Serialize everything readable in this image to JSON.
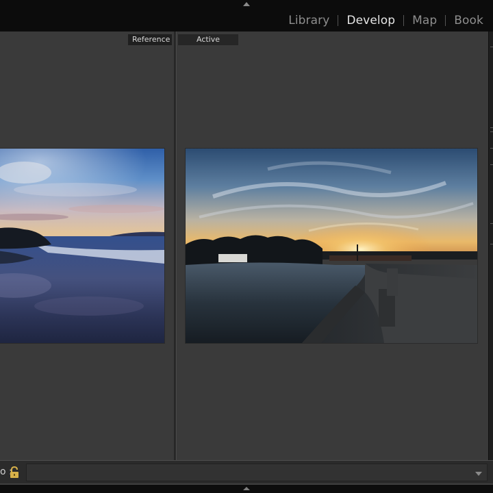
{
  "module_picker": {
    "items": [
      {
        "label": "Library",
        "active": false
      },
      {
        "label": "Develop",
        "active": true
      },
      {
        "label": "Map",
        "active": false
      },
      {
        "label": "Book",
        "active": false
      }
    ]
  },
  "compare_view": {
    "reference_label": "Reference",
    "active_label": "Active"
  },
  "toolbar": {
    "sync_fragment": "o :"
  },
  "icons": {
    "top_panel_toggle": "triangle-up-icon",
    "lock": "padlock-icon",
    "toolbar_menu": "chevron-down-icon",
    "bottom_panel_toggle": "triangle-up-icon"
  },
  "colors": {
    "app_background": "#1a1a1a",
    "canvas_background": "#3a3a3a",
    "active_module_text": "#e6e6e6",
    "inactive_module_text": "#8e8e8e",
    "lock_icon": "#d8b14a"
  }
}
